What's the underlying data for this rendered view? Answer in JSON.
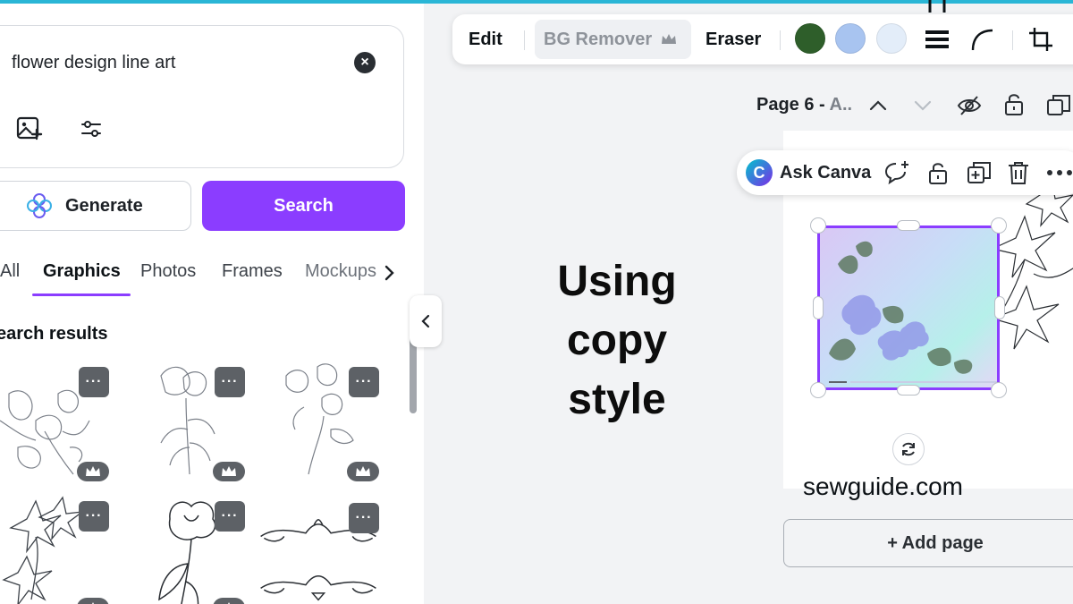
{
  "search": {
    "query": "flower design line art",
    "generate_label": "Generate",
    "search_label": "Search"
  },
  "tabs": [
    {
      "label": "All",
      "active": false
    },
    {
      "label": "Graphics",
      "active": true
    },
    {
      "label": "Photos",
      "active": false
    },
    {
      "label": "Frames",
      "active": false
    },
    {
      "label": "Mockups",
      "active": false
    }
  ],
  "results": {
    "title": "earch results",
    "more_label": "···",
    "items": [
      {
        "icon": "flower-sketch-1"
      },
      {
        "icon": "flower-sketch-2"
      },
      {
        "icon": "flower-sketch-3"
      },
      {
        "icon": "lily-corner"
      },
      {
        "icon": "poppy-stem"
      },
      {
        "icon": "flourish-divider"
      }
    ]
  },
  "toolbar": {
    "edit_label": "Edit",
    "bg_remover_label": "BG Remover",
    "eraser_label": "Eraser",
    "swatches": [
      "#2e5e2a",
      "#a8c4f0",
      "#e3edf9"
    ]
  },
  "page_controls": {
    "label_main": "Page 6 - ",
    "label_fade": "A.."
  },
  "overlay": {
    "lines": [
      "Using",
      "copy",
      "style"
    ]
  },
  "ask_canva": {
    "logo_letter": "C",
    "label": "Ask Canva"
  },
  "canvas": {
    "watermark": "sewguide.com",
    "add_page_label": "+ Add page"
  },
  "colors": {
    "accent": "#8b3dff",
    "top_strip": "#2ab6d6"
  }
}
